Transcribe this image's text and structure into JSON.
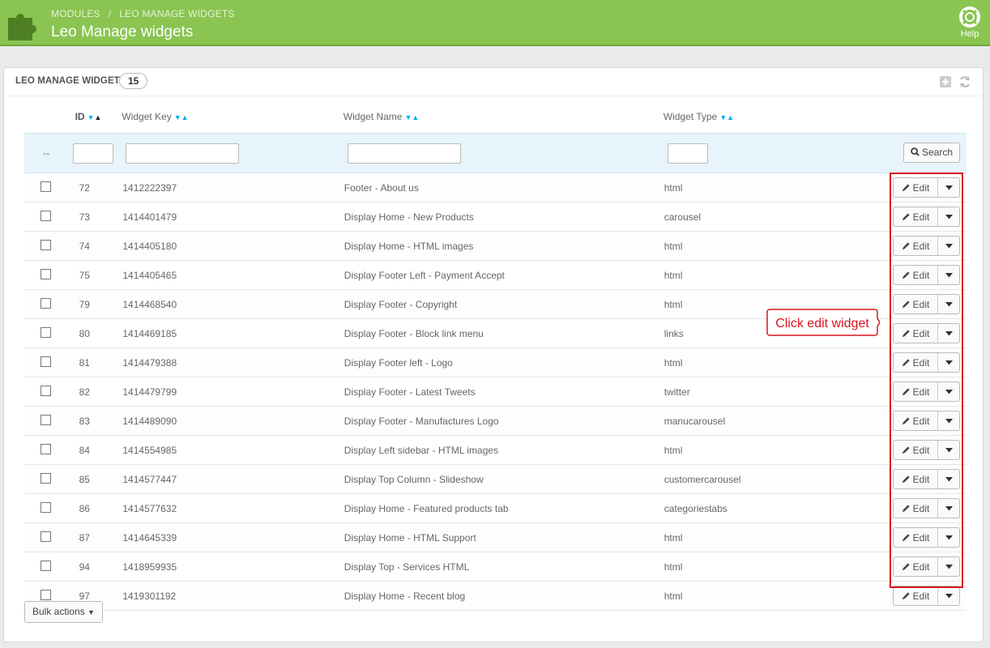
{
  "header": {
    "breadcrumb_1": "MODULES",
    "breadcrumb_sep": "/",
    "breadcrumb_2": "LEO MANAGE WIDGETS",
    "title": "Leo Manage widgets",
    "help_label": "Help"
  },
  "panel": {
    "title": "LEO MANAGE WIDGETS",
    "count": "15"
  },
  "columns": {
    "id": "ID",
    "key": "Widget Key",
    "name": "Widget Name",
    "type": "Widget Type"
  },
  "filter": {
    "dash": "--",
    "search_label": "Search"
  },
  "rows": [
    {
      "id": "72",
      "key": "1412222397",
      "name": "Footer - About us",
      "type": "html"
    },
    {
      "id": "73",
      "key": "1414401479",
      "name": "Display Home - New Products",
      "type": "carousel"
    },
    {
      "id": "74",
      "key": "1414405180",
      "name": "Display Home - HTML images",
      "type": "html"
    },
    {
      "id": "75",
      "key": "1414405465",
      "name": "Display Footer Left - Payment Accept",
      "type": "html"
    },
    {
      "id": "79",
      "key": "1414468540",
      "name": "Display Footer - Copyright",
      "type": "html"
    },
    {
      "id": "80",
      "key": "1414469185",
      "name": "Display Footer - Block link menu",
      "type": "links"
    },
    {
      "id": "81",
      "key": "1414479388",
      "name": "Display Footer left - Logo",
      "type": "html"
    },
    {
      "id": "82",
      "key": "1414479799",
      "name": "Display Footer - Latest Tweets",
      "type": "twitter"
    },
    {
      "id": "83",
      "key": "1414489090",
      "name": "Display Footer - Manufactures Logo",
      "type": "manucarousel"
    },
    {
      "id": "84",
      "key": "1414554985",
      "name": "Display Left sidebar - HTML images",
      "type": "html"
    },
    {
      "id": "85",
      "key": "1414577447",
      "name": "Display Top Column - Slideshow",
      "type": "customercarousel"
    },
    {
      "id": "86",
      "key": "1414577632",
      "name": "Display Home - Featured products tab",
      "type": "categoriestabs"
    },
    {
      "id": "87",
      "key": "1414645339",
      "name": "Display Home - HTML Support",
      "type": "html"
    },
    {
      "id": "94",
      "key": "1418959935",
      "name": "Display Top - Services HTML",
      "type": "html"
    },
    {
      "id": "97",
      "key": "1419301192",
      "name": "Display Home - Recent blog",
      "type": "html"
    }
  ],
  "row_action": {
    "edit_label": "Edit"
  },
  "callout": {
    "text": "Click edit widget"
  },
  "bulk": {
    "label": "Bulk actions"
  },
  "colors": {
    "header_green": "#8ac451",
    "filter_blue": "#e7f4fb",
    "sort_arrow": "#00aff0",
    "highlight_red": "#d9141e"
  }
}
